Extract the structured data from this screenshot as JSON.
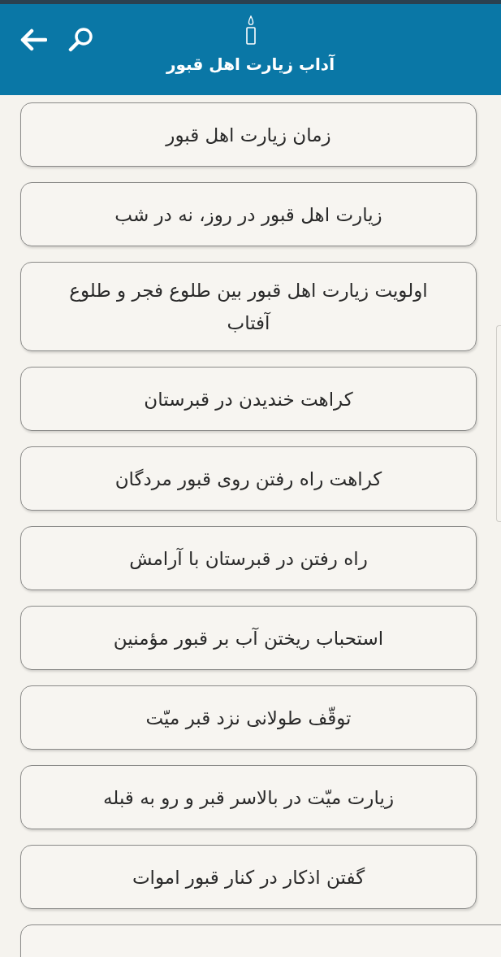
{
  "header": {
    "title": "آداب زیارت اهل قبور"
  },
  "items": [
    {
      "label": "زمان زیارت اهل قبور"
    },
    {
      "label": "زیارت اهل قبور در روز، نه در شب"
    },
    {
      "label": "اولویت زیارت اهل قبور بین طلوع فجر و طلوع آفتاب"
    },
    {
      "label": "کراهت خندیدن در قبرستان"
    },
    {
      "label": "کراهت راه رفتن روی قبور مردگان"
    },
    {
      "label": "راه رفتن در قبرستان با آرامش"
    },
    {
      "label": "استحباب ریختن آب بر قبور مؤمنین"
    },
    {
      "label": "توقّف طولانی نزد قبر میّت"
    },
    {
      "label": "زیارت میّت در بالاسر قبر و رو به قبله"
    },
    {
      "label": "گفتن اذکار در کنار قبور اموات"
    }
  ]
}
